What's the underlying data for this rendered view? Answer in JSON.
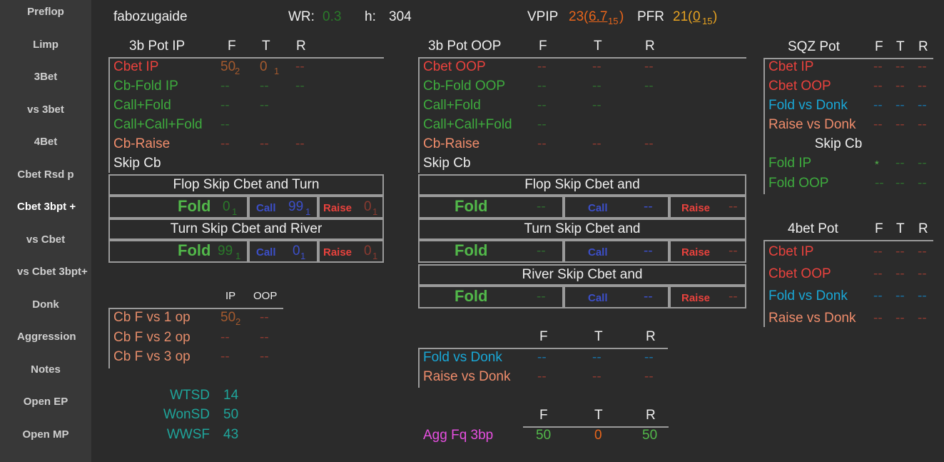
{
  "sidebar": [
    "Preflop",
    "Limp",
    "3Bet",
    "vs 3bet",
    "4Bet",
    "Cbet Rsd p",
    "Cbet 3bpt +",
    "vs Cbet",
    "vs Cbet 3bpt+",
    "Donk",
    "Aggression",
    "Notes",
    "Open EP",
    "Open MP"
  ],
  "header": {
    "player": "fabozugaide",
    "wr_label": "WR:",
    "wr_value": "0.3",
    "h_label": "h:",
    "h_value": "304",
    "vpip_label": "VPIP",
    "vpip_value": "23",
    "vpip_paren_open": "(",
    "vpip_sub": "6.7",
    "vpip_sub_n": "15",
    "vpip_paren_close": ")",
    "pfr_label": "PFR",
    "pfr_value": "21",
    "pfr_paren_open": "(",
    "pfr_sub": "0",
    "pfr_sub_n": "15",
    "pfr_paren_close": ")"
  },
  "ip": {
    "title": "3b Pot IP",
    "cols": [
      "F",
      "T",
      "R"
    ],
    "rows": [
      {
        "label": "Cbet IP",
        "v": [
          "50",
          "0",
          "--"
        ],
        "n": [
          "2",
          "1",
          ""
        ]
      },
      {
        "label": "Cb-Fold IP",
        "v": [
          "--",
          "--",
          "--"
        ]
      },
      {
        "label": "Call+Fold",
        "v": [
          "--",
          "--"
        ]
      },
      {
        "label": "Call+Call+Fold",
        "v": [
          "--"
        ]
      },
      {
        "label": "Cb-Raise",
        "v": [
          "--",
          "--",
          "--"
        ]
      },
      {
        "label": "Skip Cb"
      }
    ],
    "flop_title": "Flop Skip Cbet and Turn",
    "turn_title": "Turn Skip Cbet and River",
    "fold": "Fold",
    "call": "Call",
    "raise": "Raise",
    "flop_vals": [
      "0",
      "99",
      "0"
    ],
    "flop_n": [
      "1",
      "1",
      "1"
    ],
    "turn_vals": [
      "99",
      "0",
      "0"
    ],
    "turn_n": [
      "1",
      "1",
      "1"
    ]
  },
  "cbf": {
    "cols": [
      "IP",
      "OOP"
    ],
    "rows": [
      {
        "label": "Cb F vs 1 op",
        "v": [
          "50",
          "--"
        ],
        "n": [
          "2",
          ""
        ]
      },
      {
        "label": "Cb F vs 2 op",
        "v": [
          "--",
          "--"
        ]
      },
      {
        "label": "Cb F vs 3 op",
        "v": [
          "--",
          "--"
        ]
      }
    ]
  },
  "wt": {
    "rows": [
      {
        "label": "WTSD",
        "v": "14"
      },
      {
        "label": "WonSD",
        "v": "50"
      },
      {
        "label": "WWSF",
        "v": "43"
      }
    ]
  },
  "oop": {
    "title": "3b  Pot OOP",
    "cols": [
      "F",
      "T",
      "R"
    ],
    "rows": [
      {
        "label": "Cbet OOP",
        "v": [
          "--",
          "--",
          "--"
        ]
      },
      {
        "label": "Cb-Fold OOP",
        "v": [
          "--",
          "--",
          "--"
        ]
      },
      {
        "label": "Call+Fold",
        "v": [
          "--",
          "--"
        ]
      },
      {
        "label": "Call+Call+Fold",
        "v": [
          "--"
        ]
      },
      {
        "label": "Cb-Raise",
        "v": [
          "--",
          "--",
          "--"
        ]
      },
      {
        "label": "Skip Cb"
      }
    ],
    "flop_title": "Flop Skip Cbet and",
    "turn_title": "Turn Skip Cbet and",
    "river_title": "River Skip Cbet and",
    "fold": "Fold",
    "call": "Call",
    "raise": "Raise",
    "dash": "--"
  },
  "donk": {
    "cols": [
      "F",
      "T",
      "R"
    ],
    "rows": [
      {
        "label": "Fold vs Donk",
        "v": [
          "--",
          "--",
          "--"
        ]
      },
      {
        "label": "Raise vs Donk",
        "v": [
          "--",
          "--",
          "--"
        ]
      }
    ]
  },
  "agg": {
    "cols": [
      "F",
      "T",
      "R"
    ],
    "label": "Agg Fq 3bp",
    "v": [
      "50",
      "0",
      "50"
    ]
  },
  "sqz": {
    "title": "SQZ Pot",
    "cols": [
      "F",
      "T",
      "R"
    ],
    "rows": [
      {
        "label": "Cbet IP",
        "v": [
          "--",
          "--",
          "--"
        ]
      },
      {
        "label": "Cbet OOP",
        "v": [
          "--",
          "--",
          "--"
        ]
      },
      {
        "label": "Fold vs Donk",
        "v": [
          "--",
          "--",
          "--"
        ]
      },
      {
        "label": "Raise vs Donk",
        "v": [
          "--",
          "--",
          "--"
        ]
      }
    ],
    "skip": "Skip Cb",
    "folds": [
      {
        "label": "Fold IP",
        "v": [
          "*",
          "--",
          "--"
        ]
      },
      {
        "label": "Fold OOP",
        "v": [
          "--",
          "--",
          "--"
        ]
      }
    ]
  },
  "fourbet": {
    "title": "4bet Pot",
    "cols": [
      "F",
      "T",
      "R"
    ],
    "rows": [
      {
        "label": "Cbet IP",
        "v": [
          "--",
          "--",
          "--"
        ]
      },
      {
        "label": "Cbet OOP",
        "v": [
          "--",
          "--",
          "--"
        ]
      },
      {
        "label": "Fold vs Donk",
        "v": [
          "--",
          "--",
          "--"
        ]
      },
      {
        "label": "Raise vs Donk",
        "v": [
          "--",
          "--",
          "--"
        ]
      }
    ]
  }
}
